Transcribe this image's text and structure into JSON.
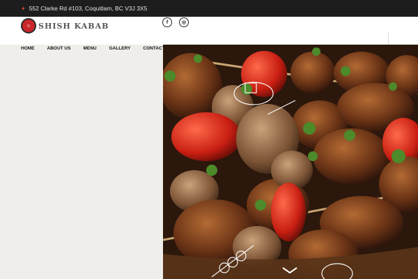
{
  "topbar": {
    "address": "552 Clarke Rd #103, Coquitlam, BC V3J 3X5",
    "pin_icon": "location-pin-icon",
    "pin_color": "#d9502c"
  },
  "header": {
    "brand": "SHISH KABAB",
    "social": [
      {
        "icon": "facebook-icon",
        "glyph": "f"
      },
      {
        "icon": "instagram-icon",
        "glyph": "◎"
      }
    ]
  },
  "nav": {
    "items": [
      "HOME",
      "ABOUT US",
      "MENU",
      "GALLERY",
      "CONTACT US"
    ]
  },
  "hero": {
    "scroll_icon": "chevron-down-icon"
  }
}
